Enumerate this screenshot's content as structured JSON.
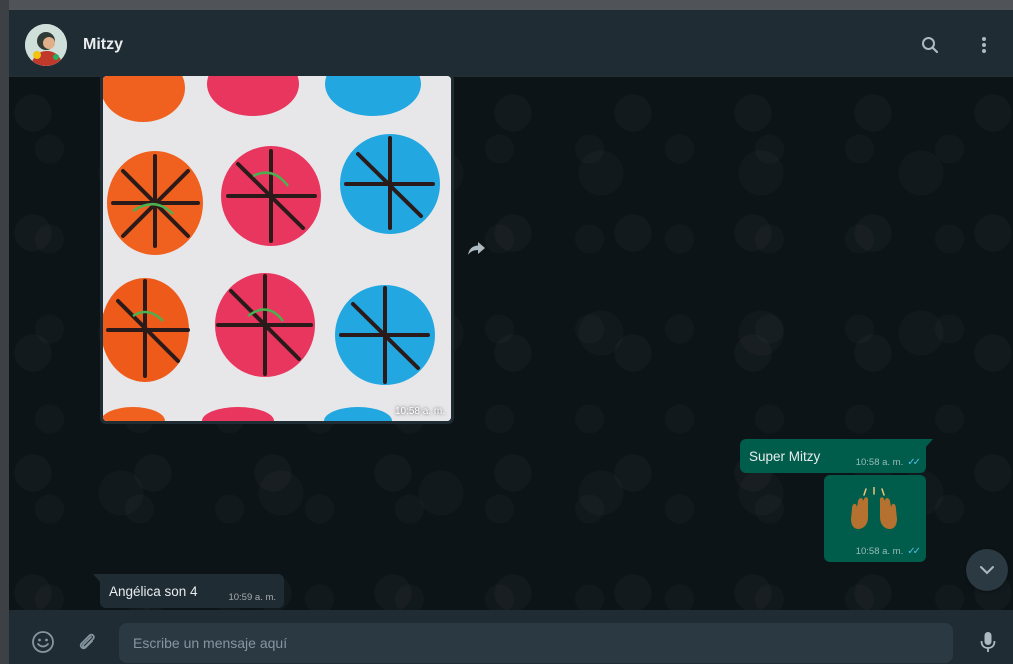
{
  "header": {
    "contact_name": "Mitzy",
    "icons": [
      "avatar",
      "search-icon",
      "menu-icon"
    ]
  },
  "messages": [
    {
      "direction": "incoming",
      "type": "image",
      "time": "10:58 a. m."
    },
    {
      "direction": "outgoing",
      "type": "text",
      "text": "Super Mitzy",
      "time": "10:58 a. m.",
      "status": "read"
    },
    {
      "direction": "outgoing",
      "type": "emoji",
      "emoji": "🙌🏾",
      "time": "10:58 a. m.",
      "status": "read"
    },
    {
      "direction": "incoming",
      "type": "text",
      "text": "Angélica son 4",
      "time": "10:59 a. m."
    }
  ],
  "footer": {
    "input_placeholder": "Escribe un mensaje aquí",
    "icons": [
      "emoji-icon",
      "attach-icon",
      "microphone-icon"
    ]
  },
  "colors": {
    "outgoing_bubble": "#005c4b",
    "incoming_bubble": "#202c33",
    "header": "#202c33",
    "chat_bg": "#0d1418",
    "read_ticks": "#53bdeb"
  }
}
